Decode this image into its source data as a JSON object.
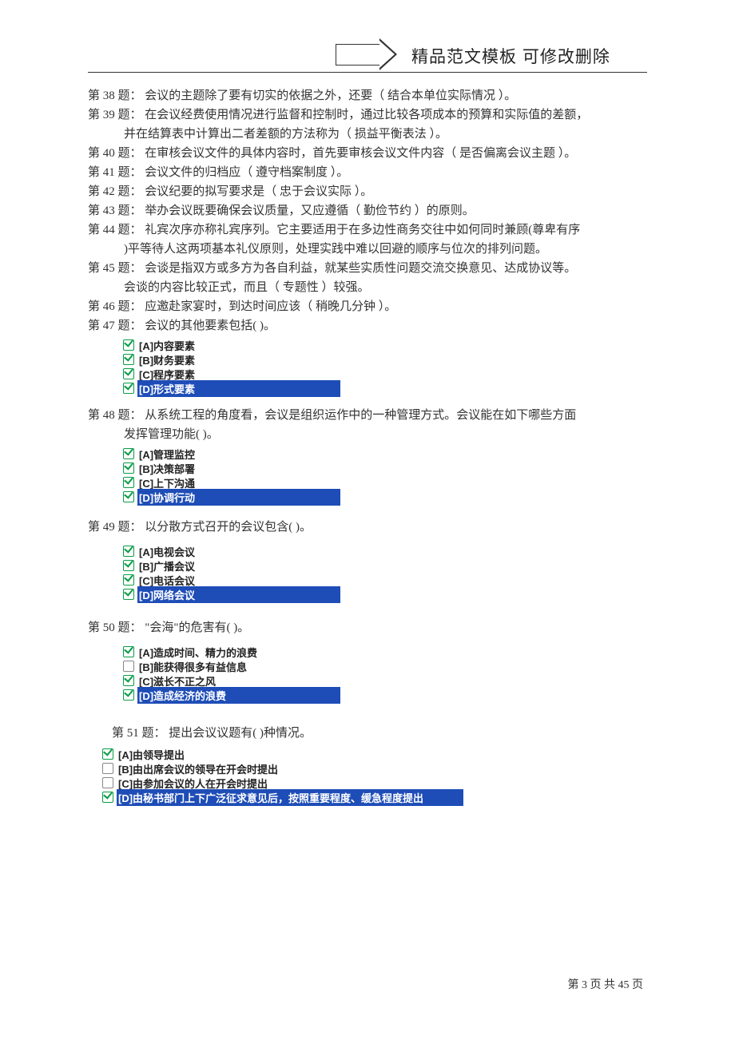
{
  "header": {
    "title": "精品范文模板  可修改删除"
  },
  "questions": {
    "q38": {
      "label": "第 38 题：",
      "text": "会议的主题除了要有切实的依据之外，还要（ 结合本单位实际情况 ）。"
    },
    "q39": {
      "label": "第 39 题：",
      "text": "在会议经费使用情况进行监督和控制时，通过比较各项成本的预算和实际值的差额，",
      "cont": "并在结算表中计算出二者差额的方法称为（ 损益平衡表法 ）。"
    },
    "q40": {
      "label": "第 40 题：",
      "text": "在审核会议文件的具体内容时，首先要审核会议文件内容（ 是否偏离会议主题 ）。"
    },
    "q41": {
      "label": "第 41 题：",
      "text": "会议文件的归档应（ 遵守档案制度 ）。"
    },
    "q42": {
      "label": "第 42 题：",
      "text": "会议纪要的拟写要求是（ 忠于会议实际 ）。"
    },
    "q43": {
      "label": "第 43 题：",
      "text": "举办会议既要确保会议质量，又应遵循（ 勤俭节约 ）的原则。"
    },
    "q44": {
      "label": "第 44 题：",
      "text": "礼宾次序亦称礼宾序列。它主要适用于在多边性商务交往中如何同时兼顾(尊卑有序",
      "cont": ")平等待人这两项基本礼仪原则，处理实践中难以回避的顺序与位次的排列问题。"
    },
    "q45": {
      "label": "第 45 题：",
      "text": "会谈是指双方或多方为各自利益，就某些实质性问题交流交换意见、达成协议等。",
      "cont": "会谈的内容比较正式，而且（ 专题性 ）较强。"
    },
    "q46": {
      "label": "第 46 题：",
      "text": "应邀赴家宴时，到达时间应该（ 稍晚几分钟 ）。"
    },
    "q47": {
      "label": "第 47 题：",
      "text": "会议的其他要素包括(   )。",
      "options": [
        {
          "label": "[A]内容要素",
          "checked": true,
          "highlighted": false
        },
        {
          "label": "[B]财务要素",
          "checked": true,
          "highlighted": false
        },
        {
          "label": "[C]程序要素",
          "checked": true,
          "highlighted": false
        },
        {
          "label": "[D]形式要素",
          "checked": true,
          "highlighted": true
        }
      ]
    },
    "q48": {
      "label": "第 48 题：",
      "text": "从系统工程的角度看，会议是组织运作中的一种管理方式。会议能在如下哪些方面",
      "cont": "发挥管理功能(   )。",
      "options": [
        {
          "label": "[A]管理监控",
          "checked": true,
          "highlighted": false
        },
        {
          "label": "[B]决策部署",
          "checked": true,
          "highlighted": false
        },
        {
          "label": "[C]上下沟通",
          "checked": true,
          "highlighted": false
        },
        {
          "label": "[D]协调行动",
          "checked": true,
          "highlighted": true
        }
      ]
    },
    "q49": {
      "label": "第 49 题：",
      "text": "以分散方式召开的会议包含(   )。",
      "options": [
        {
          "label": "[A]电视会议",
          "checked": true,
          "highlighted": false
        },
        {
          "label": "[B]广播会议",
          "checked": true,
          "highlighted": false
        },
        {
          "label": "[C]电话会议",
          "checked": true,
          "highlighted": false
        },
        {
          "label": "[D]网络会议",
          "checked": true,
          "highlighted": true
        }
      ]
    },
    "q50": {
      "label": "第 50 题：",
      "text": "\"会海\"的危害有(   )。",
      "options": [
        {
          "label": "[A]造成时间、精力的浪费",
          "checked": true,
          "highlighted": false
        },
        {
          "label": "[B]能获得很多有益信息",
          "checked": false,
          "highlighted": false
        },
        {
          "label": "[C]滋长不正之风",
          "checked": true,
          "highlighted": false
        },
        {
          "label": "[D]造成经济的浪费",
          "checked": true,
          "highlighted": true
        }
      ]
    },
    "q51": {
      "label": "第 51 题：",
      "text": "提出会议议题有(   )种情况。",
      "options": [
        {
          "label": "[A]由领导提出",
          "checked": true,
          "highlighted": false
        },
        {
          "label": "[B]由出席会议的领导在开会时提出",
          "checked": false,
          "highlighted": false
        },
        {
          "label": "[C]由参加会议的人在开会时提出",
          "checked": false,
          "highlighted": false
        },
        {
          "label": "[D]由秘书部门上下广泛征求意见后，按照重要程度、缓急程度提出",
          "checked": true,
          "highlighted": true
        }
      ]
    }
  },
  "footer": {
    "page": "第 3 页 共 45 页"
  }
}
